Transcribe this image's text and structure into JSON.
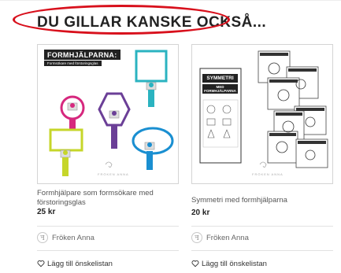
{
  "section": {
    "heading": "DU GILLAR KANSKE OCKSÅ..."
  },
  "products": [
    {
      "image": {
        "title": "FORMHJÄLPARNA:",
        "subtitle": "Formsökare med förstoringsglas",
        "brand": "FRÖKEN ANNA",
        "shape_colors": [
          "#d6287e",
          "#6b3f97",
          "#2bb3c0",
          "#c6d62a",
          "#1a8fd1"
        ]
      },
      "title": "Formhjälpare som formsökare med förstoringsglas",
      "price": "25 kr",
      "seller": "Fröken Anna",
      "wishlist": "Lägg till önskelistan"
    },
    {
      "image": {
        "banner": "SYMMETRI",
        "banner_sub": "MED FORMHJÄLPARNA",
        "brand": "FRÖKEN ANNA"
      },
      "title": "Symmetri med formhjälparna",
      "price": "20 kr",
      "seller": "Fröken Anna",
      "wishlist": "Lägg till önskelistan"
    }
  ],
  "colors": {
    "highlight_ellipse": "#d8101c"
  }
}
